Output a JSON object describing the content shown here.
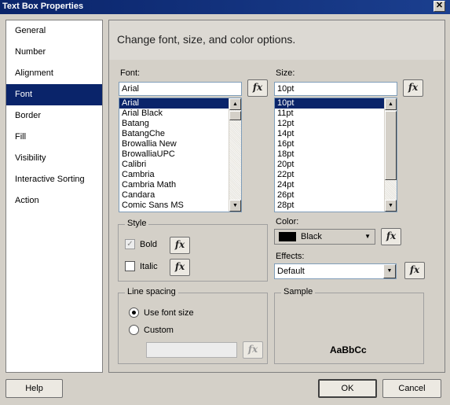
{
  "window": {
    "title": "Text Box Properties",
    "close_glyph": "✕"
  },
  "sidebar": {
    "items": [
      {
        "label": "General"
      },
      {
        "label": "Number"
      },
      {
        "label": "Alignment"
      },
      {
        "label": "Font"
      },
      {
        "label": "Border"
      },
      {
        "label": "Fill"
      },
      {
        "label": "Visibility"
      },
      {
        "label": "Interactive Sorting"
      },
      {
        "label": "Action"
      }
    ],
    "selected": "Font"
  },
  "main": {
    "heading": "Change font, size, and color options.",
    "font": {
      "label": "Font:",
      "value": "Arial",
      "options": [
        "Arial",
        "Arial Black",
        "Batang",
        "BatangChe",
        "Browallia New",
        "BrowalliaUPC",
        "Calibri",
        "Cambria",
        "Cambria Math",
        "Candara",
        "Comic Sans MS"
      ],
      "selected": "Arial"
    },
    "size": {
      "label": "Size:",
      "value": "10pt",
      "options": [
        "10pt",
        "11pt",
        "12pt",
        "14pt",
        "16pt",
        "18pt",
        "20pt",
        "22pt",
        "24pt",
        "26pt",
        "28pt"
      ],
      "selected": "10pt"
    },
    "fx_label": "fx",
    "style": {
      "label": "Style",
      "bold_label": "Bold",
      "bold_checked": true,
      "italic_label": "Italic",
      "italic_checked": false
    },
    "color": {
      "label": "Color:",
      "value": "Black",
      "swatch_hex": "#000000"
    },
    "effects": {
      "label": "Effects:",
      "value": "Default"
    },
    "line_spacing": {
      "label": "Line spacing",
      "option_use_font_size": "Use font size",
      "option_custom": "Custom",
      "selected": "Use font size",
      "custom_value": ""
    },
    "sample": {
      "label": "Sample",
      "text": "AaBbCc"
    }
  },
  "footer": {
    "help": "Help",
    "ok": "OK",
    "cancel": "Cancel"
  },
  "icons": {
    "scroll_up": "▲",
    "scroll_down": "▼",
    "dropdown": "▼",
    "check": "✓"
  },
  "colors": {
    "selection": "#0a246a",
    "titlebar": "#0a246a",
    "dialog_bg": "#d4d0c8"
  }
}
